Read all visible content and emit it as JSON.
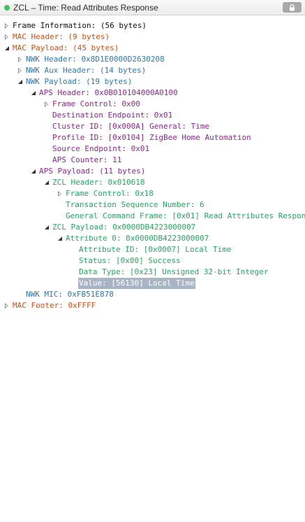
{
  "window": {
    "title": "ZCL – Time: Read Attributes Response",
    "status_color": "#3cc45a"
  },
  "tree": {
    "frame_information": "Frame Information: (56 bytes)",
    "mac_header": "MAC Header: (9 bytes)",
    "mac_payload": "MAC Payload: (45 bytes)",
    "nwk_header": "NWK Header: 0x8D1E0000D2630208",
    "nwk_aux_header": "NWK Aux Header: (14 bytes)",
    "nwk_payload": "NWK Payload: (19 bytes)",
    "aps_header": "APS Header: 0x0B010104000A0100",
    "aps_frame_control": "Frame Control: 0x00",
    "destination_endpoint": "Destination Endpoint: 0x01",
    "cluster_id": "Cluster ID: [0x000A] General: Time",
    "profile_id": "Profile ID: [0x0104] ZigBee Home Automation",
    "source_endpoint": "Source Endpoint: 0x01",
    "aps_counter": "APS Counter: 11",
    "aps_payload": "APS Payload: (11 bytes)",
    "zcl_header": "ZCL Header: 0x010618",
    "zcl_frame_control": "Frame Control: 0x18",
    "transaction_sequence": "Transaction Sequence Number: 6",
    "general_command_frame": "General Command Frame: [0x01] Read Attributes Respon",
    "zcl_payload": "ZCL Payload: 0x0000DB4223000007",
    "attribute_0": "Attribute 0: 0x0000DB4223000007",
    "attribute_id": "Attribute ID: [0x0007] Local Time",
    "status": "Status: [0x00] Success",
    "data_type": "Data Type: [0x23] Unsigned 32-bit Integer",
    "value": "Value: [56130] Local Time",
    "nwk_mic": "NWK MIC: 0xFB51E878",
    "mac_footer": "MAC Footer: 0xFFFF"
  },
  "colors": {
    "frame": "#111111",
    "mac": "#d2511a",
    "nwk": "#2f79b3",
    "aps": "#8a2b8e",
    "zcl": "#2aa562",
    "selection": "#a8b5c5"
  }
}
